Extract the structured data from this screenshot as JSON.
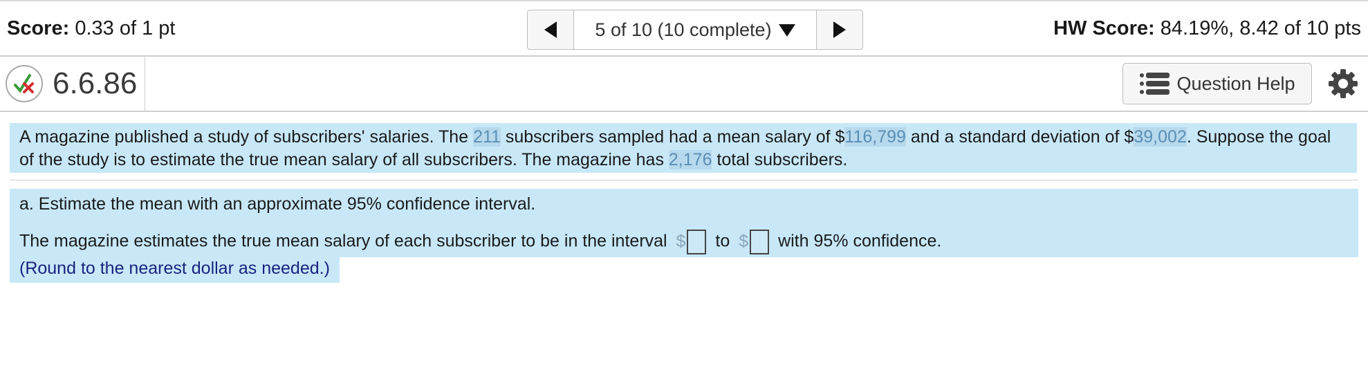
{
  "header": {
    "score_label": "Score:",
    "score_value": "0.33 of 1 pt",
    "nav_label": "5 of 10 (10 complete)",
    "hw_label": "HW Score:",
    "hw_value": "84.19%, 8.42 of 10 pts"
  },
  "question": {
    "number": "6.6.86",
    "help_label": "Question Help",
    "status_icon": "partial-credit-icon"
  },
  "problem": {
    "t1": "A magazine published a study of subscribers' salaries. The ",
    "n_sampled": "211",
    "t2": " subscribers sampled had a mean salary of $",
    "mean": "116,799",
    "t3": " and a standard deviation of $",
    "sd": "39,002",
    "t4": ". Suppose the goal of the study is to estimate the true mean salary of all subscribers. The magazine has ",
    "total": "2,176",
    "t5": " total subscribers."
  },
  "part_a": {
    "prompt": "a. Estimate the mean with an approximate 95% confidence interval.",
    "answer_pre": "The magazine estimates the true mean salary of each subscriber to be in the interval ",
    "dollar": "$",
    "to": "to",
    "answer_post": "with 95% confidence.",
    "round_note": "(Round to the nearest dollar as needed.)"
  },
  "colors": {
    "highlight": "#c8e8f8",
    "number": "#5b8fb4",
    "note": "#1a237e"
  }
}
